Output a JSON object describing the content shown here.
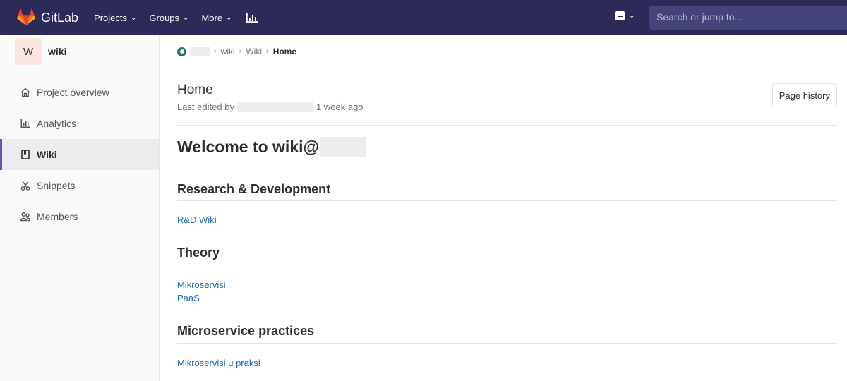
{
  "navbar": {
    "brand": "GitLab",
    "menu": [
      {
        "label": "Projects"
      },
      {
        "label": "Groups"
      },
      {
        "label": "More"
      }
    ],
    "search_placeholder": "Search or jump to..."
  },
  "sidebar": {
    "project_initial": "W",
    "project_name": "wiki",
    "items": [
      {
        "label": "Project overview",
        "icon": "home-icon"
      },
      {
        "label": "Analytics",
        "icon": "chart-icon"
      },
      {
        "label": "Wiki",
        "icon": "book-icon",
        "active": true
      },
      {
        "label": "Snippets",
        "icon": "scissors-icon"
      },
      {
        "label": "Members",
        "icon": "users-icon"
      }
    ]
  },
  "breadcrumb": {
    "items": [
      "wiki",
      "Wiki"
    ],
    "current": "Home"
  },
  "page": {
    "title": "Home",
    "last_edited_prefix": "Last edited by",
    "last_edited_time": "1 week ago",
    "history_button": "Page history"
  },
  "content": {
    "heading": "Welcome to wiki@",
    "sections": [
      {
        "title": "Research & Development",
        "links": [
          "R&D Wiki"
        ]
      },
      {
        "title": "Theory",
        "links": [
          "Mikroservisi",
          "PaaS"
        ]
      },
      {
        "title": "Microservice practices",
        "links": [
          "Mikroservisi u praksi"
        ]
      }
    ]
  },
  "colors": {
    "navbar": "#2b2a59",
    "link": "#1b69b6",
    "active_border": "#6b4fbb"
  }
}
